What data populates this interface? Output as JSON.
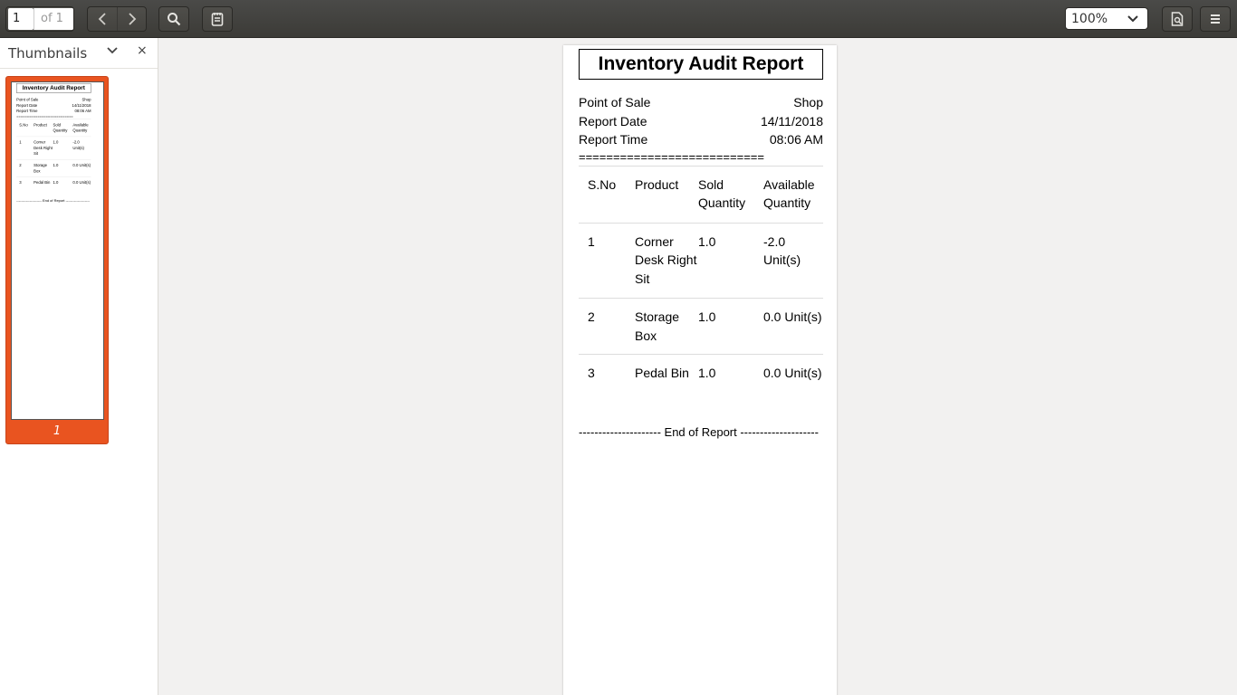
{
  "toolbar": {
    "page_current": "1",
    "page_total": "of 1",
    "zoom": "100%",
    "icons": [
      "prev-page-icon",
      "next-page-icon",
      "search-icon",
      "annotations-icon",
      "document-properties-icon",
      "menu-icon"
    ]
  },
  "sidebar": {
    "title": "Thumbnails",
    "close": "×",
    "thumb_number": "1"
  },
  "report": {
    "title": "Inventory Audit Report",
    "meta": [
      {
        "label": "Point of Sale",
        "value": "Shop"
      },
      {
        "label": "Report Date",
        "value": "14/11/2018"
      },
      {
        "label": "Report Time",
        "value": "08:06 AM"
      }
    ],
    "separator": "===========================",
    "headers": {
      "sno": "S.No",
      "product": "Product",
      "sold": "Sold Quantity",
      "available": "Available Quantity"
    },
    "rows": [
      {
        "sno": "1",
        "product": "Corner Desk Right Sit",
        "sold": "1.0",
        "available": "-2.0 Unit(s)"
      },
      {
        "sno": "2",
        "product": "Storage Box",
        "sold": "1.0",
        "available": "0.0 Unit(s)"
      },
      {
        "sno": "3",
        "product": "Pedal Bin",
        "sold": "1.0",
        "available": "0.0 Unit(s)"
      }
    ],
    "end_line": "--------------------- End of Report --------------------"
  }
}
